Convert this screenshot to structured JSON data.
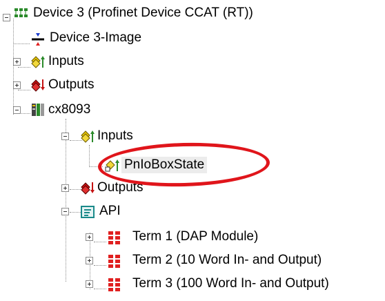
{
  "tree": {
    "root": {
      "label": "Device 3 (Profinet Device CCAT (RT))",
      "icon": "profinet-device-icon"
    },
    "image": {
      "label": "Device 3-Image",
      "icon": "process-image-icon"
    },
    "inputs": {
      "label": "Inputs",
      "icon": "inputs-icon"
    },
    "outputs": {
      "label": "Outputs",
      "icon": "outputs-icon"
    },
    "box": {
      "label": "cx8093",
      "icon": "module-box-icon"
    },
    "box_inputs": {
      "label": "Inputs",
      "icon": "inputs-icon"
    },
    "pnio_box_state": {
      "label": "PnIoBoxState",
      "icon": "input-variable-icon"
    },
    "box_outputs": {
      "label": "Outputs",
      "icon": "outputs-icon"
    },
    "api": {
      "label": "API",
      "icon": "api-icon"
    },
    "terms": [
      {
        "label": "Term 1 (DAP Module)",
        "icon": "terminal-icon"
      },
      {
        "label": "Term 2 (10 Word In- and Output)",
        "icon": "terminal-icon"
      },
      {
        "label": "Term 3 (100 Word In- and Output)",
        "icon": "terminal-icon"
      }
    ]
  },
  "annotation": {
    "color": "#e0151b"
  }
}
